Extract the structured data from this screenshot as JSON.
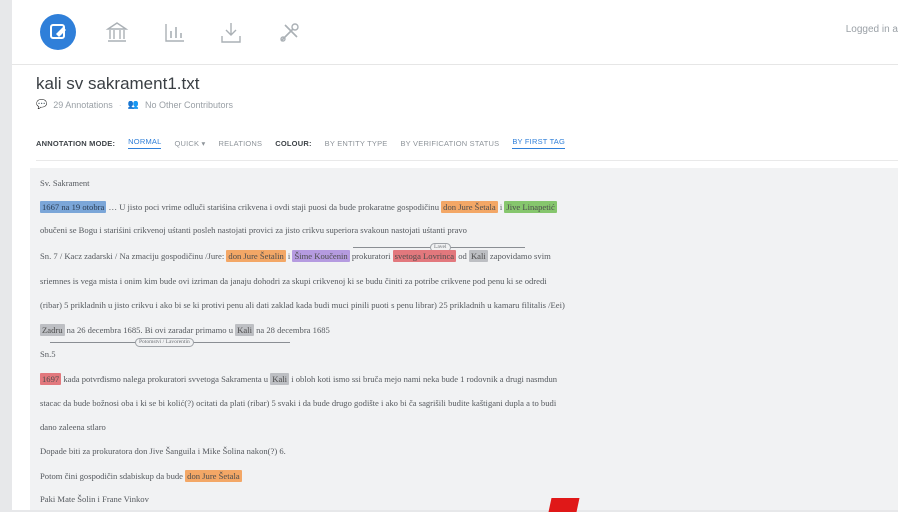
{
  "toolbar": {
    "icons": [
      "annotation-icon",
      "bank-icon",
      "chart-icon",
      "download-icon",
      "tools-icon"
    ],
    "login_text": "Logged in a",
    "accent": "#2f7fd9"
  },
  "document": {
    "title": "kali sv sakrament1.txt",
    "annotations_count": "29 Annotations",
    "contributors": "No Other Contributors"
  },
  "modebar": {
    "annotation_mode_label": "ANNOTATION MODE:",
    "normal": "NORMAL",
    "quick": "QUICK ▾",
    "relations": "RELATIONS",
    "colour_label": "COLOUR:",
    "by_entity_type": "BY ENTITY TYPE",
    "by_verification_status": "BY VERIFICATION STATUS",
    "by_first_tag": "BY FIRST TAG"
  },
  "text": {
    "l1": "Sv. Sakrament",
    "l2_hl1": "1667 na 19 otobra",
    "l2_mid": " … U jisto poci vrime odluči stariśina crikvena i ovdi staji puosi da bude prokaratne gospodičinu ",
    "l2_hl2": "don Jure Šetala",
    "l2_mid2": " i ",
    "l2_hl3": "Jive Linapetić",
    "l3": "obučeni se Bogu i stariśini crikvenoj uśtanti posleh nastojati provici za jisto crikvu superiora svakoun nastojati uśtanti pravo",
    "l4_pre": "Sn. 7 / Kacz zadarski / Na zmaciju gospodičinu /Jure: ",
    "l4_hl1": "don Jure Šetalin",
    "l4_mid": " i ",
    "l4_hl2": "Šime Koučenin",
    "l4_mid2": " prokuratori ",
    "l4_hl3": "svetoga Lovrinca",
    "l4_mid3": " od ",
    "l4_hl4": "Kali",
    "l4_post": " zapovidamo svim",
    "l5": "sriemnes is vega mista i onim kim bude ovi izriman da janaju dohodri za skupi crikvenoj ki se budu činiti za potribe crikvene pod penu ki se odredi",
    "l6": "(ribar) 5 prikladnih u jisto crikvu i ako bi se ki protivi penu ali dati zaklad kada budi muci pinili puoti s penu librar) 25 prikladnih u kamaru filitalis /Eei)",
    "l7_hl1": "Zadru",
    "l7_mid": " na 26 decembra 1685. Bi ovi zaradar primamo u ",
    "l7_hl2": "Kali",
    "l7_post": " na 28 decembra 1685",
    "l8": "Sn.5",
    "l9_hl": "1697",
    "l9_mid": " kada potvrđismo nalega prokuratori svvetoga Sakramenta u ",
    "l9_hl2": "Kali",
    "l9_post": " i obloh koti ismo ssi bruča mejo nami neka bude 1 rodovnik a drugi nasmdun",
    "l10": "stacac da bude božnosi oba i ki se bi kolić(?) ocitati da plati (ribar) 5 svaki i da bude drugo godište i ako bi ča sagrišili budite kaštigani dupla a to budi",
    "l11": "dano zaleena stlaro",
    "l12": "Dopade biti za prokuratora don Jive Šanguila i Mike Šolina nakon(?) 6.",
    "l13_pre": "Potom čini gospodičin sdabiskup da bude ",
    "l13_hl": "don Jure Šetala",
    "l14": "Paki Mate Šolin i Frane Vinkov",
    "rel1": "Lavel",
    "rel2": "Potomstvi / Lavorentin"
  }
}
